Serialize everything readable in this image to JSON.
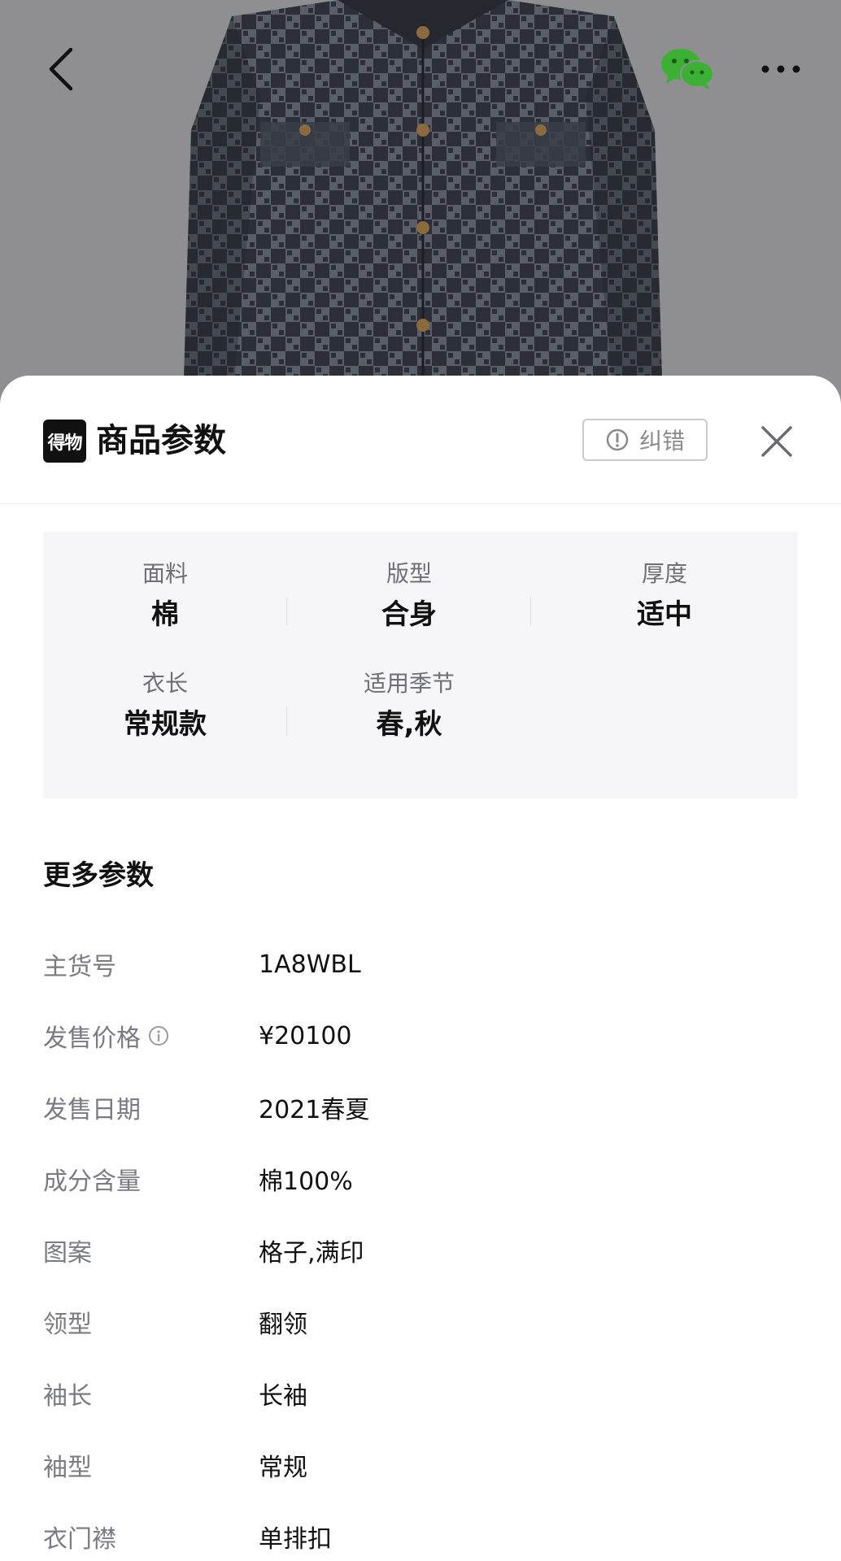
{
  "topbar": {
    "back_icon": "chevron-left-icon",
    "share_icon": "wechat-icon",
    "more_icon": "more-dots-icon",
    "more_glyph": "···",
    "wechat_color": "#3cb035"
  },
  "sheet": {
    "brand_logo_text": "得物",
    "title": "商品参数",
    "report_label": "纠错",
    "report_icon": "alert-circle-icon",
    "close_icon": "close-icon"
  },
  "key_params": [
    {
      "label": "面料",
      "value": "棉"
    },
    {
      "label": "版型",
      "value": "合身"
    },
    {
      "label": "厚度",
      "value": "适中"
    },
    {
      "label": "衣长",
      "value": "常规款"
    },
    {
      "label": "适用季节",
      "value": "春,秋"
    }
  ],
  "more_params": {
    "title": "更多参数",
    "rows": [
      {
        "key": "主货号",
        "value": "1A8WBL"
      },
      {
        "key": "发售价格",
        "value": "¥20100",
        "info_icon": "info-circle-icon"
      },
      {
        "key": "发售日期",
        "value": "2021春夏"
      },
      {
        "key": "成分含量",
        "value": "棉100%"
      },
      {
        "key": "图案",
        "value": "格子,满印"
      },
      {
        "key": "领型",
        "value": "翻领"
      },
      {
        "key": "袖长",
        "value": "长袖"
      },
      {
        "key": "袖型",
        "value": "常规"
      },
      {
        "key": "衣门襟",
        "value": "单排扣"
      }
    ]
  },
  "colors": {
    "photo_bg": "#8f8f91",
    "jacket": "#2e3038",
    "panel_bg": "#f6f6f9",
    "label_gray": "#7a7a82",
    "text_dark": "#111111"
  }
}
